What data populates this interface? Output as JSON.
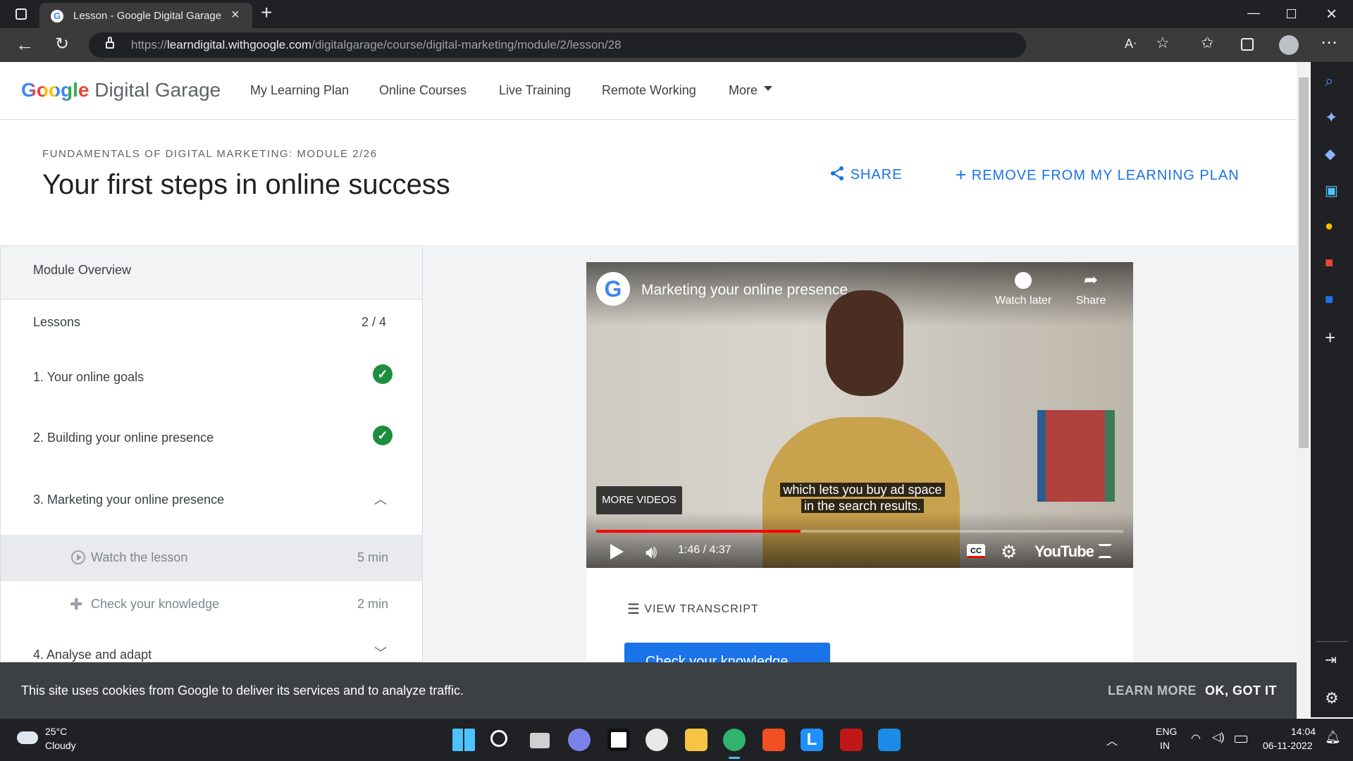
{
  "browser": {
    "tab_title": "Lesson - Google Digital Garage",
    "url_prefix": "https://",
    "url_host": "learndigital.withgoogle.com",
    "url_path": "/digitalgarage/course/digital-marketing/module/2/lesson/28"
  },
  "site": {
    "logo_google": "Google",
    "logo_rest": "Digital Garage",
    "nav": [
      "My Learning Plan",
      "Online Courses",
      "Live Training",
      "Remote Working",
      "More"
    ]
  },
  "course": {
    "eyebrow": "FUNDAMENTALS OF DIGITAL MARKETING: MODULE 2/26",
    "title": "Your first steps in online success",
    "share": "SHARE",
    "remove": "REMOVE FROM MY LEARNING PLAN"
  },
  "sidebar": {
    "overview": "Module Overview",
    "lessons_label": "Lessons",
    "lessons_count": "2 / 4",
    "items": [
      {
        "label": "1. Your online goals",
        "status": "done"
      },
      {
        "label": "2. Building your online presence",
        "status": "done"
      },
      {
        "label": "3. Marketing your online presence",
        "status": "open"
      },
      {
        "label": "4. Analyse and adapt",
        "status": "closed"
      }
    ],
    "sub": [
      {
        "label": "Watch the lesson",
        "time": "5 min"
      },
      {
        "label": "Check your knowledge",
        "time": "2 min"
      }
    ]
  },
  "video": {
    "title": "Marketing your online presence",
    "watch_later": "Watch later",
    "share": "Share",
    "more_videos": "MORE VIDEOS",
    "caption_line1": "which lets you buy ad space",
    "caption_line2": "in the search results.",
    "time": "1:46 / 4:37",
    "progress": 0.388,
    "youtube": "YouTube"
  },
  "lesson": {
    "transcript": "VIEW TRANSCRIPT",
    "check_button": "Check your knowledge"
  },
  "cookie": {
    "text": "This site uses cookies from Google to deliver its services and to analyze traffic.",
    "learn_more": "LEARN MORE",
    "ok": "OK, GOT IT"
  },
  "taskbar": {
    "temp": "25°C",
    "weather": "Cloudy",
    "lang1": "ENG",
    "lang2": "IN",
    "time": "14:04",
    "date": "06-11-2022"
  },
  "colors": {
    "blue": "#1a73e8",
    "green": "#1e8e3e",
    "red": "#ff0000"
  }
}
